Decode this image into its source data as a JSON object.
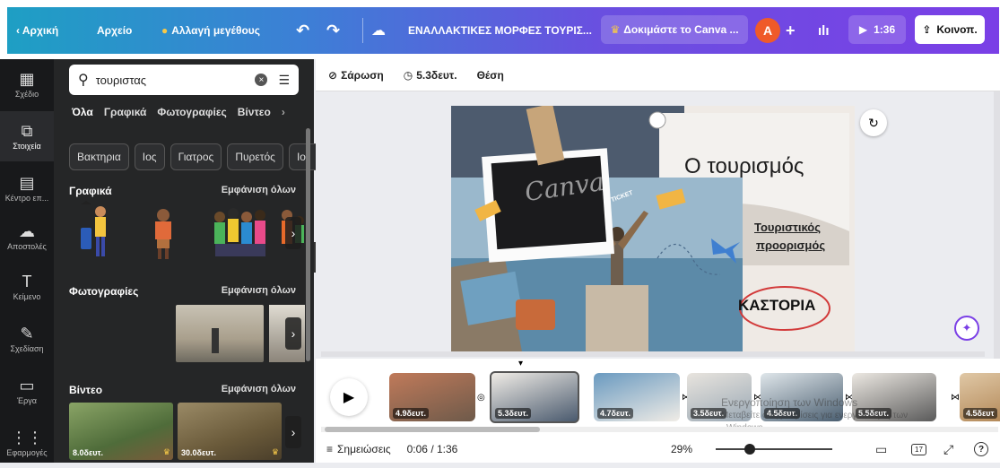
{
  "topbar": {
    "home": "‹  Αρχική",
    "file": "Αρχείο",
    "resize": "Αλλαγή μεγέθους",
    "title": "ΕΝΑΛΛΑΚΤΙΚΕΣ ΜΟΡΦΕΣ ΤΟΥΡΙΣ...",
    "try_canva": "Δοκιμάστε το Canva ...",
    "avatar_letter": "A",
    "play_time": "1:36",
    "share": "Κοινοπ."
  },
  "rail": [
    {
      "label": "Σχέδιο",
      "icon": "▦"
    },
    {
      "label": "Στοιχεία",
      "icon": "⧉"
    },
    {
      "label": "Κέντρο επ...",
      "icon": "▤"
    },
    {
      "label": "Αποστολές",
      "icon": "☁"
    },
    {
      "label": "Κείμενο",
      "icon": "T"
    },
    {
      "label": "Σχεδίαση",
      "icon": "✎"
    },
    {
      "label": "Έργα",
      "icon": "▭"
    },
    {
      "label": "Εφαρμογές",
      "icon": "⋮⋮"
    }
  ],
  "panel": {
    "search_value": "τουριστας",
    "tabs": [
      "Όλα",
      "Γραφικά",
      "Φωτογραφίες",
      "Βίντεο"
    ],
    "chips": [
      "Βακτηρια",
      "Ιος",
      "Γιατρος",
      "Πυρετός",
      "Ιο"
    ],
    "graphics_title": "Γραφικά",
    "photos_title": "Φωτογραφίες",
    "videos_title": "Βίντεο",
    "see_all": "Εμφάνιση όλων",
    "video1_dur": "8.0δευτ.",
    "video2_dur": "30.0δευτ."
  },
  "canvasbar": {
    "scan": "Σάρωση",
    "duration": "5.3δευτ.",
    "position": "Θέση"
  },
  "slide": {
    "title": "Ο τουρισμός",
    "subtitle_line1": "Τουριστικός",
    "subtitle_line2": "προορισμός",
    "destination": "ΚΑΣΤΟΡΙΑ",
    "watermark": "Canva",
    "ticket": "TICKET"
  },
  "timeline": {
    "thumbs": [
      {
        "label": "4.9δευτ."
      },
      {
        "label": "5.3δευτ."
      },
      {
        "label": "4.7δευτ."
      },
      {
        "label": "3.5δευτ."
      },
      {
        "label": "4.5δευτ."
      },
      {
        "label": "5.5δευτ."
      },
      {
        "label": "4.5δευτ"
      }
    ],
    "windows_line1": "Ενεργοποίηση των Windows",
    "windows_line2": "Μεταβείτε στις ρυθμίσεις για ενεργοποίηση των",
    "windows_line3": "Windows."
  },
  "status": {
    "notes": "Σημειώσεις",
    "time": "0:06 / 1:36",
    "zoom": "29%",
    "zoom_level": 0.29,
    "pages": "17"
  },
  "colors": {
    "accent_purple": "#7a3fe6",
    "accent_teal": "#1e9fc4",
    "avatar": "#ef5a2a",
    "selected": "#3a6fe0"
  }
}
